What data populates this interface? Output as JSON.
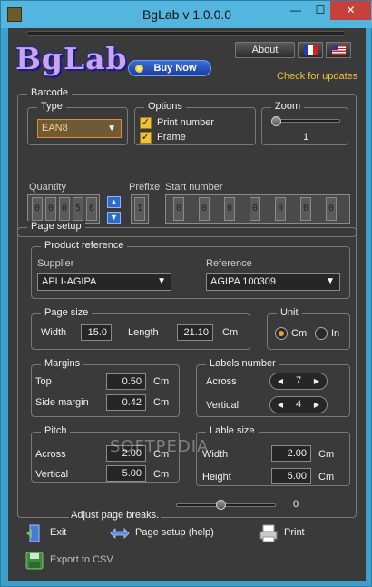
{
  "window": {
    "title": "BgLab v 1.0.0.0",
    "minimize": "—",
    "maximize": "☐",
    "close": "✕"
  },
  "header": {
    "logo": "BgLab",
    "about_label": "About",
    "buy_label": "Buy Now",
    "check_updates": "Check for updates"
  },
  "barcode": {
    "legend": "Barcode",
    "type_legend": "Type",
    "type_value": "EAN8",
    "options_legend": "Options",
    "print_number": "Print number",
    "frame": "Frame",
    "zoom_legend": "Zoom",
    "zoom_value": "1",
    "quantity_label": "Quantity",
    "quantity_digits": [
      "0",
      "0",
      "0",
      "5",
      "6"
    ],
    "prefix_label": "Préfixe",
    "prefix_digit": "1",
    "start_label": "Start number",
    "start_digits": [
      "0",
      "0",
      "0",
      "0",
      "0",
      "0",
      "0"
    ]
  },
  "page_setup": {
    "legend": "Page setup",
    "product_ref_legend": "Product reference",
    "supplier_label": "Supplier",
    "supplier_value": "APLI-AGIPA",
    "reference_label": "Reference",
    "reference_value": "AGIPA 100309",
    "page_size_legend": "Page size",
    "width_label": "Width",
    "width_value": "15.0",
    "length_label": "Length",
    "length_value": "21.10",
    "length_unit": "Cm",
    "unit_legend": "Unit",
    "unit_cm": "Cm",
    "unit_in": "In",
    "margins_legend": "Margins",
    "top_label": "Top",
    "top_value": "0.50",
    "side_label": "Side margin",
    "side_value": "0.42",
    "margin_unit": "Cm",
    "labels_number_legend": "Labels number",
    "across_label": "Across",
    "across_value": "7",
    "vertical_label": "Vertical",
    "vertical_value": "4",
    "pitch_legend": "Pitch",
    "pitch_across_label": "Across",
    "pitch_across_value": "2.00",
    "pitch_vertical_label": "Vertical",
    "pitch_vertical_value": "5.00",
    "pitch_unit": "Cm",
    "lable_size_legend": "Lable size",
    "ls_width_label": "Width",
    "ls_width_value": "2.00",
    "ls_height_label": "Height",
    "ls_height_value": "5.00",
    "ls_unit": "Cm",
    "adjust_label": "Adjust page breaks.",
    "adjust_value": "0"
  },
  "actions": {
    "exit": "Exit",
    "page_setup_help": "Page setup (help)",
    "print": "Print",
    "export_csv": "Export to CSV"
  },
  "watermark": "SOFTPEDIA"
}
